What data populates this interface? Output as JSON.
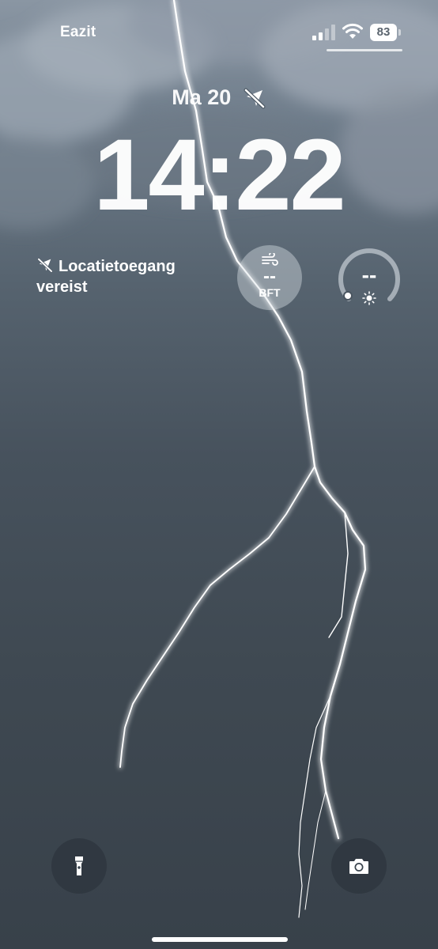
{
  "status_bar": {
    "carrier": "Eazit",
    "battery_percent": "83",
    "signal_bars_active": 2,
    "signal_bars_total": 4
  },
  "lock_screen": {
    "date": "Ma 20",
    "time": "14:22"
  },
  "widgets": {
    "location": {
      "line1": "Locatietoegang",
      "line2": "vereist"
    },
    "wind": {
      "value": "--",
      "unit": "BFT"
    },
    "uv": {
      "value": "--"
    }
  },
  "quick_actions": {
    "left_icon": "flashlight-icon",
    "right_icon": "camera-icon"
  },
  "colors": {
    "sky_top": "#8a96a3",
    "sky_bottom": "#38414a",
    "text": "#ffffff",
    "button_bg": "#283038"
  }
}
